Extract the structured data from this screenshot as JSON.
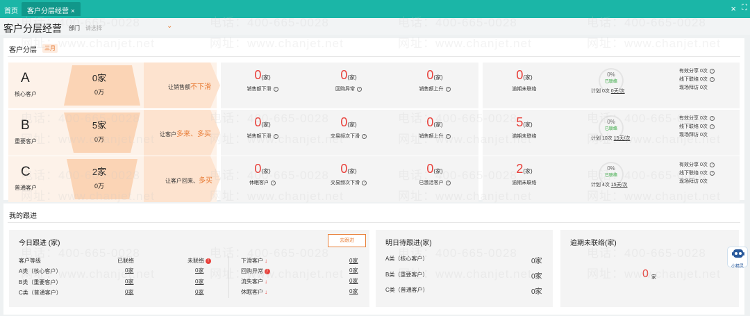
{
  "topbar": {
    "home": "首页",
    "tab_label": "客户分层经营",
    "close_tab": "×",
    "close_all": "×",
    "fullscreen": "⛶"
  },
  "header": {
    "title": "客户分层经营",
    "dept_label": "部门",
    "dept_placeholder": "请选择",
    "chevron": "⌄"
  },
  "segments": {
    "title": "客户分层",
    "badge": "三月",
    "rows": [
      {
        "letter": "A",
        "sub": "核心客户",
        "count": "0家",
        "amount": "0万",
        "slogan_prefix": "让销售额",
        "slogan_hl": "不下滑",
        "m1": {
          "num": "0",
          "unit": "(家)",
          "label": "销售额下滑"
        },
        "m2": {
          "num": "0",
          "unit": "(家)",
          "label": "回购异常"
        },
        "m3": {
          "num": "0",
          "unit": "(家)",
          "label": "销售额上升"
        },
        "m4": {
          "num": "0",
          "unit": "(家)",
          "label": "逾期未联络"
        },
        "gauge": {
          "pct": "0%",
          "status": "已联络"
        },
        "plan": {
          "prefix": "计划 0次 ",
          "link": "0天/次"
        },
        "side": [
          "有效分享 0次",
          "线下联络 0次",
          "现场拜访 0次"
        ]
      },
      {
        "letter": "B",
        "sub": "重要客户",
        "count": "5家",
        "amount": "0万",
        "slogan_prefix": "让客户",
        "slogan_hl": "多来、多买",
        "m1": {
          "num": "0",
          "unit": "(家)",
          "label": "销售额下滑"
        },
        "m2": {
          "num": "0",
          "unit": "(家)",
          "label": "交易频次下滑"
        },
        "m3": {
          "num": "0",
          "unit": "(家)",
          "label": "销售额上升"
        },
        "m4": {
          "num": "5",
          "unit": "(家)",
          "label": "逾期未联络"
        },
        "gauge": {
          "pct": "0%",
          "status": "已联络"
        },
        "plan": {
          "prefix": "计划 10次 ",
          "link": "15天/次"
        },
        "side": [
          "有效分享 0次",
          "线下联络 0次",
          "现场拜访 0次"
        ]
      },
      {
        "letter": "C",
        "sub": "普通客户",
        "count": "2家",
        "amount": "0万",
        "slogan_prefix": "让客户回来、",
        "slogan_hl": "多买",
        "m1": {
          "num": "0",
          "unit": "(家)",
          "label": "休眠客户"
        },
        "m2": {
          "num": "0",
          "unit": "(家)",
          "label": "交易频次下滑"
        },
        "m3": {
          "num": "0",
          "unit": "(家)",
          "label": "已激活客户"
        },
        "m4": {
          "num": "2",
          "unit": "(家)",
          "label": "逾期未联络"
        },
        "gauge": {
          "pct": "0%",
          "status": "已联络"
        },
        "plan": {
          "prefix": "计划 4次 ",
          "link": "15天/次"
        },
        "side": [
          "有效分享 0次",
          "线下联络 0次",
          "现场拜访 0次"
        ]
      }
    ]
  },
  "followup": {
    "title": "我的跟进",
    "today": {
      "title": "今日跟进 (家)",
      "button": "去跟进",
      "col_level": "客户等级",
      "col_contacted": "已联络",
      "col_uncontacted": "未联络",
      "rows": [
        {
          "level": "A类（核心客户）",
          "contacted": "0家",
          "uncontacted": "0家"
        },
        {
          "level": "B类（重要客户）",
          "contacted": "0家",
          "uncontacted": "0家"
        },
        {
          "level": "C类（普通客户）",
          "contacted": "0家",
          "uncontacted": "0家"
        }
      ],
      "right": [
        {
          "label": "下滑客户",
          "value": "0家",
          "icon": "down"
        },
        {
          "label": "回购异常",
          "value": "0家",
          "icon": "alert"
        },
        {
          "label": "流失客户",
          "value": "0家",
          "icon": "down"
        },
        {
          "label": "休眠客户",
          "value": "0家",
          "icon": "down"
        }
      ]
    },
    "tomorrow": {
      "title": "明日待跟进(家)",
      "rows": [
        {
          "level": "A类（核心客户）",
          "value": "0家"
        },
        {
          "level": "B类（重要客户）",
          "value": "0家"
        },
        {
          "level": "C类（普通客户）",
          "value": "0家"
        }
      ]
    },
    "overdue": {
      "title": "逾期未联络(家)",
      "value": "0",
      "unit": "家"
    }
  },
  "assistant": {
    "label": "小精灵"
  },
  "watermark": {
    "phone": "电话：400-665-0028",
    "site": "网址：www.chanjet.net"
  },
  "colors": {
    "brand": "#1bb6a7",
    "accent": "#e87a33",
    "alert": "#e8403a",
    "success": "#2aa336"
  }
}
